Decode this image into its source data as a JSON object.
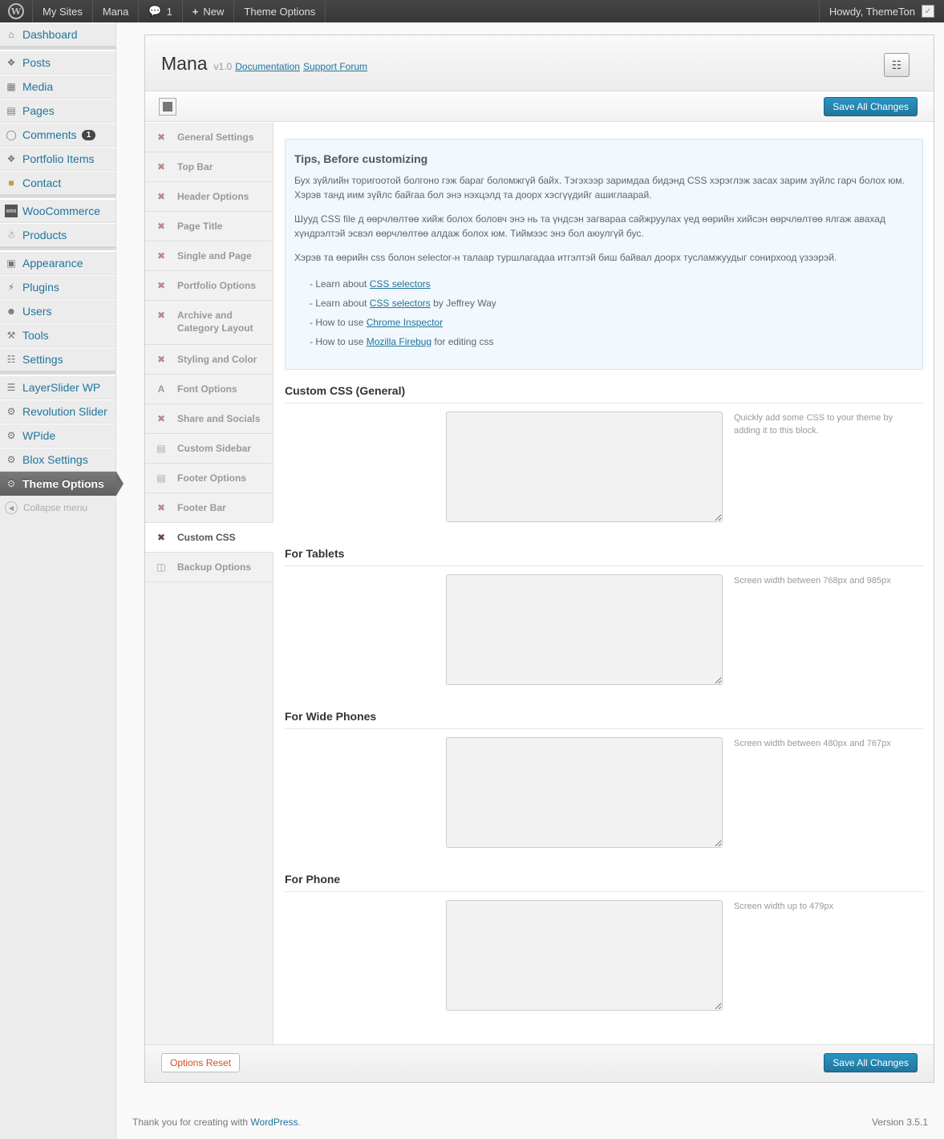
{
  "adminbar": {
    "my_sites": "My Sites",
    "site_name": "Mana",
    "comments_count": "1",
    "new_label": "New",
    "theme_options": "Theme Options",
    "howdy": "Howdy, ThemeTon"
  },
  "menu": {
    "dashboard": "Dashboard",
    "posts": "Posts",
    "media": "Media",
    "pages": "Pages",
    "comments": "Comments",
    "comments_badge": "1",
    "portfolio": "Portfolio Items",
    "contact": "Contact",
    "woocommerce": "WooCommerce",
    "products": "Products",
    "appearance": "Appearance",
    "plugins": "Plugins",
    "users": "Users",
    "tools": "Tools",
    "settings": "Settings",
    "layerslider": "LayerSlider WP",
    "revolution": "Revolution Slider",
    "wpide": "WPide",
    "blox": "Blox Settings",
    "theme_options": "Theme Options",
    "collapse": "Collapse menu"
  },
  "header": {
    "theme_name": "Mana",
    "version": "v1.0",
    "doc_link": "Documentation",
    "support_link": "Support Forum"
  },
  "buttons": {
    "save": "Save All Changes",
    "reset": "Options Reset"
  },
  "tabs": [
    "General Settings",
    "Top Bar",
    "Header Options",
    "Page Title",
    "Single and Page",
    "Portfolio Options",
    "Archive and Category Layout",
    "Styling and Color",
    "Font Options",
    "Share and Socials",
    "Custom Sidebar",
    "Footer Options",
    "Footer Bar",
    "Custom CSS",
    "Backup Options"
  ],
  "tips": {
    "title": "Tips, Before customizing",
    "p1": "Бух зүйлийн торигоотой болгоно гэж бараг боломжгүй байх. Тэгэхээр заримдаа бидэнд CSS хэрэглэж засах зарим зүйлс гарч болох юм. Хэрэв танд иим зүйлс байгаа бол энэ нэхцэлд та доорх хэсгүүдийг ашиглаарай.",
    "p2": "Шууд CSS file д өөрчлөлтөө хийж болох боловч энэ нь та үндсэн загвараа сайжруулах үед өөрийн хийсэн өөрчлөлтөө ялгаж авахад хүндрэлтэй эсвэл өөрчлөлтөө алдаж болох юм. Тиймээс энэ бол аюулгүй бус.",
    "p3": "Хэрэв та өөрийн css болон selector-н талаар туршлагадаа итгэлтэй биш байвал доорх тусламжуудыг сонирхоод үзээрэй.",
    "items": [
      {
        "pre": "- Learn about ",
        "link": "CSS selectors",
        "post": ""
      },
      {
        "pre": "- Learn about ",
        "link": "CSS selectors",
        "post": " by Jeffrey Way"
      },
      {
        "pre": "- How to use ",
        "link": "Chrome Inspector",
        "post": ""
      },
      {
        "pre": "- How to use ",
        "link": "Mozilla Firebug",
        "post": " for editing css"
      }
    ]
  },
  "sections": [
    {
      "title": "Custom CSS (General)",
      "value": "",
      "desc": "Quickly add some CSS to your theme by adding it to this block."
    },
    {
      "title": "For Tablets",
      "value": "",
      "desc": "Screen width between 768px and 985px"
    },
    {
      "title": "For Wide Phones",
      "value": "",
      "desc": "Screen width between 480px and 767px"
    },
    {
      "title": "For Phone",
      "value": "",
      "desc": "Screen width up to 479px"
    }
  ],
  "footer": {
    "thanks": "Thank you for creating with ",
    "wp_link": "WordPress",
    "dot": ".",
    "version": "Version 3.5.1"
  },
  "colors": {
    "accent": "#21759b",
    "reset": "#d54e21",
    "adminbar": "#464646"
  }
}
